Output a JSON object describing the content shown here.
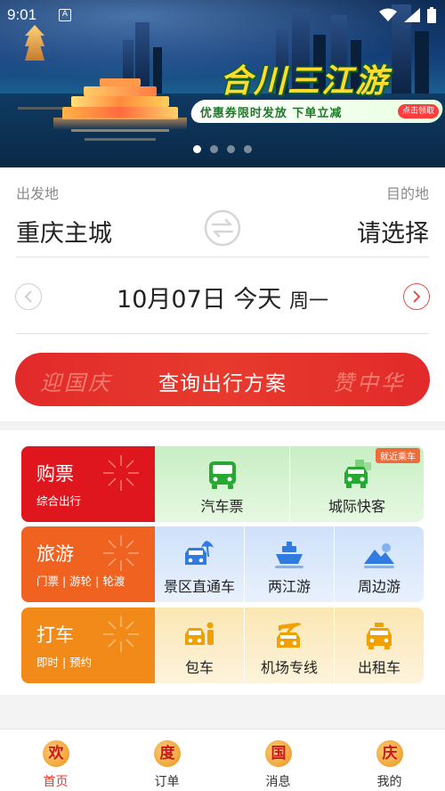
{
  "status_bar": {
    "time": "9:01",
    "notification_letter": "A"
  },
  "banner": {
    "title": "合川三江游",
    "subtitle": "优惠券限时发放  下单立减",
    "cta": "点击领取",
    "page_count": 4,
    "active_page": 0
  },
  "route": {
    "from_label": "出发地",
    "to_label": "目的地",
    "from_city": "重庆主城",
    "to_city": "请选择",
    "date": "10月07日 今天",
    "weekday": "周一",
    "search_button": "查询出行方案",
    "deco_left": "迎国庆",
    "deco_right": "赞中华"
  },
  "services": {
    "rows": [
      {
        "title": "购票",
        "subtitle": "综合出行",
        "items": [
          {
            "label": "汽车票",
            "icon": "bus-icon"
          },
          {
            "label": "城际快客",
            "icon": "intercity-car-icon",
            "tag": "就近乘车"
          }
        ]
      },
      {
        "title": "旅游",
        "subtitle": "门票 | 游轮 | 轮渡",
        "items": [
          {
            "label": "景区直通车",
            "icon": "scenic-bus-icon"
          },
          {
            "label": "两江游",
            "icon": "cruise-ship-icon"
          },
          {
            "label": "周边游",
            "icon": "mountain-icon"
          }
        ]
      },
      {
        "title": "打车",
        "subtitle": "即时 | 预约",
        "items": [
          {
            "label": "包车",
            "icon": "chauffeur-car-icon"
          },
          {
            "label": "机场专线",
            "icon": "airport-car-icon"
          },
          {
            "label": "出租车",
            "icon": "taxi-icon"
          }
        ]
      }
    ]
  },
  "nav": {
    "items": [
      {
        "label": "首页",
        "glyph": "欢",
        "active": true
      },
      {
        "label": "订单",
        "glyph": "度",
        "active": false
      },
      {
        "label": "消息",
        "glyph": "国",
        "active": false
      },
      {
        "label": "我的",
        "glyph": "庆",
        "active": false
      }
    ]
  },
  "colors": {
    "primary_red": "#e22a2a",
    "buy_red": "#e0161e",
    "travel_orange": "#ef6220",
    "taxi_orange": "#f28a1a",
    "bus_green": "#27a833",
    "travel_blue": "#2f7be0",
    "taxi_amber": "#f2a000"
  }
}
